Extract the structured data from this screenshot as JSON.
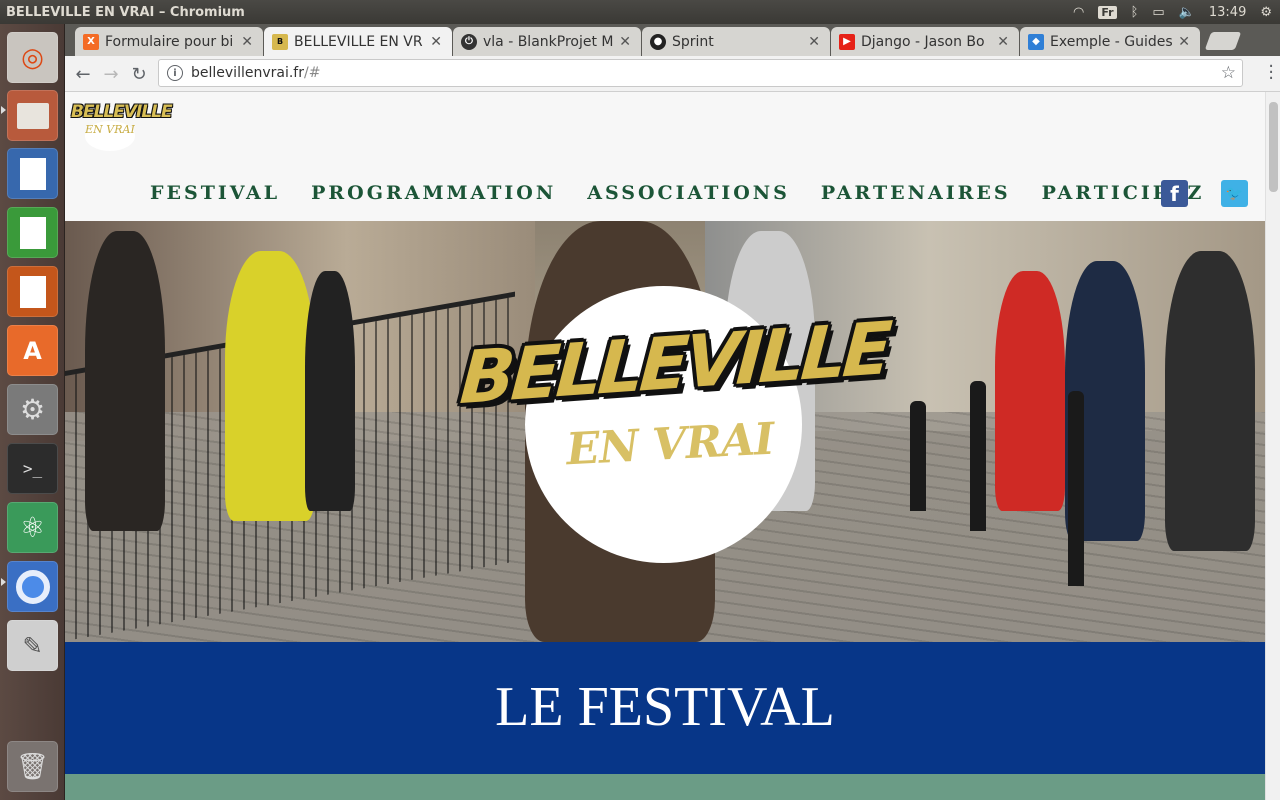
{
  "os": {
    "window_title": "BELLEVILLE EN VRAI – Chromium",
    "keyboard_layout": "Fr",
    "clock": "13:49",
    "launcher": [
      "ubuntu-dash",
      "files",
      "writer",
      "calc",
      "impress",
      "software-center",
      "system-settings",
      "terminal",
      "atom",
      "chromium",
      "text-editor",
      "trash"
    ]
  },
  "browser": {
    "tabs": [
      {
        "label": "Formulaire pour bi",
        "favicon": "xampp-icon",
        "active": false
      },
      {
        "label": "BELLEVILLE EN VR",
        "favicon": "belleville-icon",
        "active": true
      },
      {
        "label": "vla - BlankProjet M",
        "favicon": "power-icon",
        "active": false
      },
      {
        "label": "Sprint",
        "favicon": "github-icon",
        "active": false
      },
      {
        "label": "Django - Jason Bo",
        "favicon": "youtube-icon",
        "active": false
      },
      {
        "label": "Exemple - Guides p",
        "favicon": "guide-icon",
        "active": false
      }
    ],
    "url_host": "bellevillenvrai.fr",
    "url_path": "/#"
  },
  "site": {
    "logo_top": "BELLEVILLE",
    "logo_bottom": "EN VRAI",
    "nav": [
      "FESTIVAL",
      "PROGRAMMATION",
      "ASSOCIATIONS",
      "PARTENAIRES",
      "PARTICIPEZ"
    ],
    "social": {
      "facebook": "f",
      "twitter": "🐦"
    },
    "hero_logo_top": "BELLEVILLE",
    "hero_logo_bottom": "EN VRAI",
    "section_title": "LE FESTIVAL",
    "colors": {
      "nav_text": "#1c5537",
      "festival_band": "#073688",
      "green_band": "#6b9c86",
      "logo_gold": "#d6b84e"
    }
  }
}
